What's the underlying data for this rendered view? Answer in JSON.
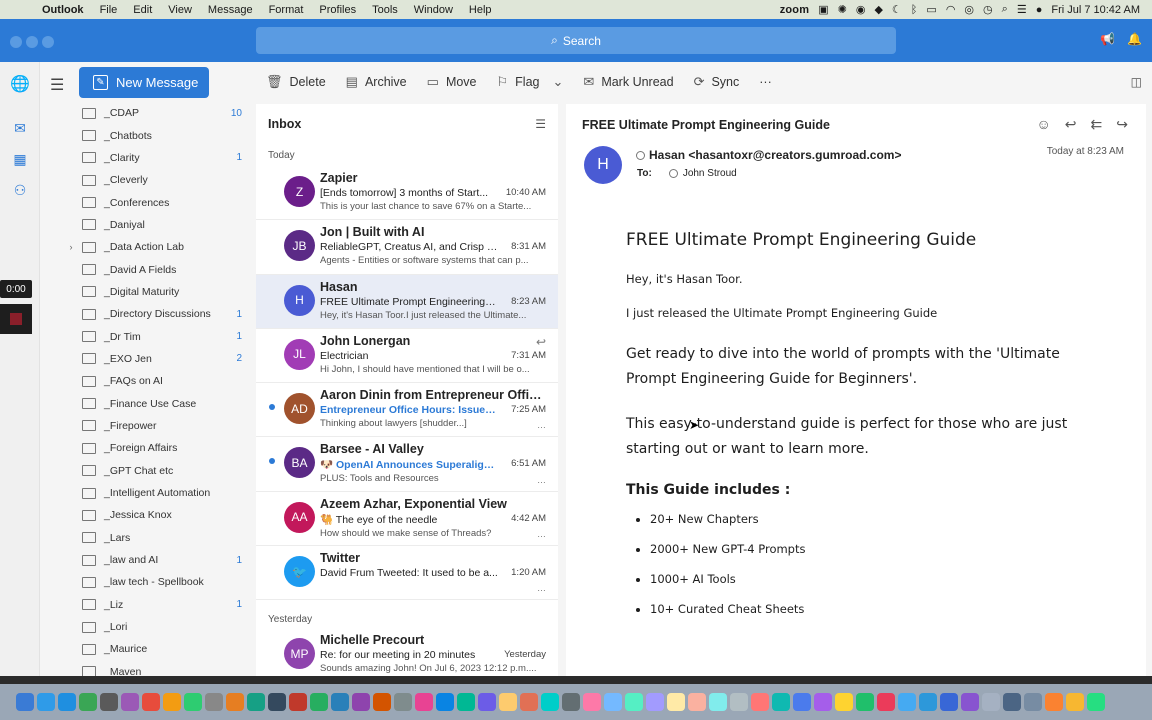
{
  "menubar": {
    "app": "Outlook",
    "items": [
      "File",
      "Edit",
      "View",
      "Message",
      "Format",
      "Profiles",
      "Tools",
      "Window",
      "Help"
    ],
    "zoom": "zoom",
    "clock": "Fri Jul 7  10:42 AM"
  },
  "titlebar": {
    "search_label": "Search"
  },
  "rail": {
    "recording_time": "0:00"
  },
  "new_message_label": "New Message",
  "toolbar": {
    "delete": "Delete",
    "archive": "Archive",
    "move": "Move",
    "flag": "Flag",
    "mark_unread": "Mark Unread",
    "sync": "Sync",
    "more": "···"
  },
  "folders": [
    {
      "name": "_CDAP",
      "count": "10"
    },
    {
      "name": "_Chatbots",
      "count": ""
    },
    {
      "name": "_Clarity",
      "count": "1"
    },
    {
      "name": "_Cleverly",
      "count": ""
    },
    {
      "name": "_Conferences",
      "count": ""
    },
    {
      "name": "_Daniyal",
      "count": ""
    },
    {
      "name": "_Data Action Lab",
      "count": "",
      "expandable": true
    },
    {
      "name": "_David A Fields",
      "count": ""
    },
    {
      "name": "_Digital Maturity",
      "count": ""
    },
    {
      "name": "_Directory Discussions",
      "count": "1"
    },
    {
      "name": "_Dr Tim",
      "count": "1"
    },
    {
      "name": "_EXO Jen",
      "count": "2"
    },
    {
      "name": "_FAQs on AI",
      "count": ""
    },
    {
      "name": "_Finance Use Case",
      "count": ""
    },
    {
      "name": "_Firepower",
      "count": ""
    },
    {
      "name": "_Foreign Affairs",
      "count": ""
    },
    {
      "name": "_GPT Chat etc",
      "count": ""
    },
    {
      "name": "_Intelligent Automation",
      "count": ""
    },
    {
      "name": "_Jessica Knox",
      "count": ""
    },
    {
      "name": "_Lars",
      "count": ""
    },
    {
      "name": "_law and AI",
      "count": "1"
    },
    {
      "name": "_law tech - Spellbook",
      "count": ""
    },
    {
      "name": "_Liz",
      "count": "1"
    },
    {
      "name": "_Lori",
      "count": ""
    },
    {
      "name": "_Maurice",
      "count": ""
    },
    {
      "name": "_Maven",
      "count": ""
    }
  ],
  "inbox": {
    "title": "Inbox",
    "group_today": "Today",
    "group_yesterday": "Yesterday",
    "messages_today": [
      {
        "initials": "Z",
        "color": "#6b1e8a",
        "from": "Zapier",
        "subject": "[Ends tomorrow] 3 months of Start...",
        "time": "10:40 AM",
        "preview": "This is your last chance to save 67% on a Starte...",
        "unread": false,
        "selected": false
      },
      {
        "initials": "JB",
        "color": "#5b2a86",
        "from": "Jon | Built with AI",
        "subject": "ReliableGPT, Creatus AI, and Crisp |...",
        "time": "8:31 AM",
        "preview": "Agents - Entities or software systems that can p...",
        "unread": false,
        "selected": false
      },
      {
        "initials": "H",
        "color": "#4a5bd4",
        "from": "Hasan",
        "subject": "FREE Ultimate Prompt Engineering G...",
        "time": "8:23 AM",
        "preview": "Hey, it's Hasan Toor.I just released the Ultimate...",
        "unread": false,
        "selected": true
      },
      {
        "initials": "JL",
        "color": "#a13cb5",
        "from": "John Lonergan",
        "subject": "Electrician",
        "time": "7:31 AM",
        "preview": "Hi John, I should have mentioned that I will be o...",
        "unread": false,
        "selected": false,
        "replied": true
      },
      {
        "initials": "AD",
        "color": "#a0522d",
        "from": "Aaron Dinin from Entrepreneur Office...",
        "subject": "Entrepreneur Office Hours: Issue #...",
        "time": "7:25 AM",
        "preview": "Thinking about lawyers [shudder...]",
        "unread": true,
        "selected": false,
        "blue": true
      },
      {
        "initials": "BA",
        "color": "#5b2a86",
        "from": "Barsee - AI Valley",
        "subject": "🐶 OpenAI Announces Superalign...",
        "time": "6:51 AM",
        "preview": "PLUS: Tools and Resources",
        "unread": true,
        "selected": false,
        "blue": true
      },
      {
        "initials": "AA",
        "color": "#c2185b",
        "from": "Azeem Azhar, Exponential View",
        "subject": "🐫 The eye of the needle",
        "time": "4:42 AM",
        "preview": "How should we make sense of Threads?",
        "unread": false,
        "selected": false
      },
      {
        "initials": "🐦",
        "color": "#1d9bf0",
        "from": "Twitter",
        "subject": "David Frum Tweeted: It used to be a...",
        "time": "1:20 AM",
        "preview": "",
        "unread": false,
        "selected": false
      }
    ],
    "messages_yesterday": [
      {
        "initials": "MP",
        "color": "#8e44ad",
        "from": "Michelle Precourt",
        "subject": "Re: for our meeting in 20 minutes",
        "time": "Yesterday",
        "preview": "Sounds amazing John! On Jul 6, 2023 12:12 p.m...."
      }
    ]
  },
  "reading": {
    "subject": "FREE Ultimate Prompt Engineering Guide",
    "sender_initial": "H",
    "sender": "Hasan <hasantoxr@creators.gumroad.com>",
    "to_label": "To:",
    "to": "John Stroud",
    "date": "Today at 8:23 AM",
    "body": {
      "heading": "FREE Ultimate Prompt Engineering Guide",
      "greeting": "Hey, it's Hasan Toor.",
      "released": "I just released the Ultimate Prompt Engineering Guide",
      "para1": "Get ready to dive into the world of prompts with the 'Ultimate Prompt Engineering Guide for Beginners'.",
      "para2": "This easy-to-understand guide is perfect for those who are just starting out or want to learn more.",
      "includes": "This Guide includes :",
      "bullets": [
        "20+ New Chapters",
        "2000+ New GPT-4 Prompts",
        "1000+ AI Tools",
        "10+ Curated Cheat Sheets"
      ]
    }
  },
  "colors": {
    "accent": "#2c7ad6",
    "selected_row": "#e8ecf6"
  }
}
